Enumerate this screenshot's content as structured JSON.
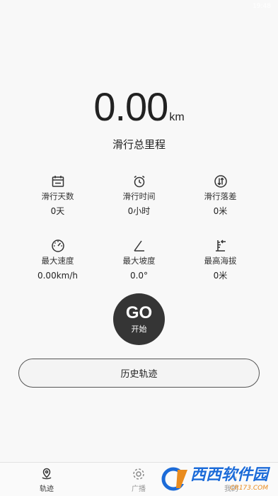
{
  "status_bar": {
    "time": "19:48"
  },
  "distance": {
    "value": "0.00",
    "unit": "km",
    "label": "滑行总里程"
  },
  "stats": [
    {
      "icon": "calendar-icon",
      "label": "滑行天数",
      "value": "0天"
    },
    {
      "icon": "alarm-clock-icon",
      "label": "滑行时间",
      "value": "0小时"
    },
    {
      "icon": "elevation-drop-icon",
      "label": "滑行落差",
      "value": "0米"
    },
    {
      "icon": "speedometer-icon",
      "label": "最大速度",
      "value": "0.00km/h"
    },
    {
      "icon": "slope-angle-icon",
      "label": "最大坡度",
      "value": "0.0°"
    },
    {
      "icon": "altitude-ruler-icon",
      "label": "最高海拔",
      "value": "0米"
    }
  ],
  "go_button": {
    "label": "GO",
    "sub_label": "开始"
  },
  "history_button": {
    "label": "历史轨迹"
  },
  "bottom_nav": [
    {
      "icon": "track-location-icon",
      "label": "轨迹"
    },
    {
      "icon": "gear-icon",
      "label": "广播"
    },
    {
      "icon": "user-icon",
      "label": "我的"
    }
  ],
  "watermark": {
    "text": "西西软件园",
    "url": "CR173.COM"
  },
  "colors": {
    "go_button": "#353535",
    "background": "#f8f8f8",
    "watermark_blue": "#1c6bd8",
    "watermark_orange": "#e98b1d"
  }
}
